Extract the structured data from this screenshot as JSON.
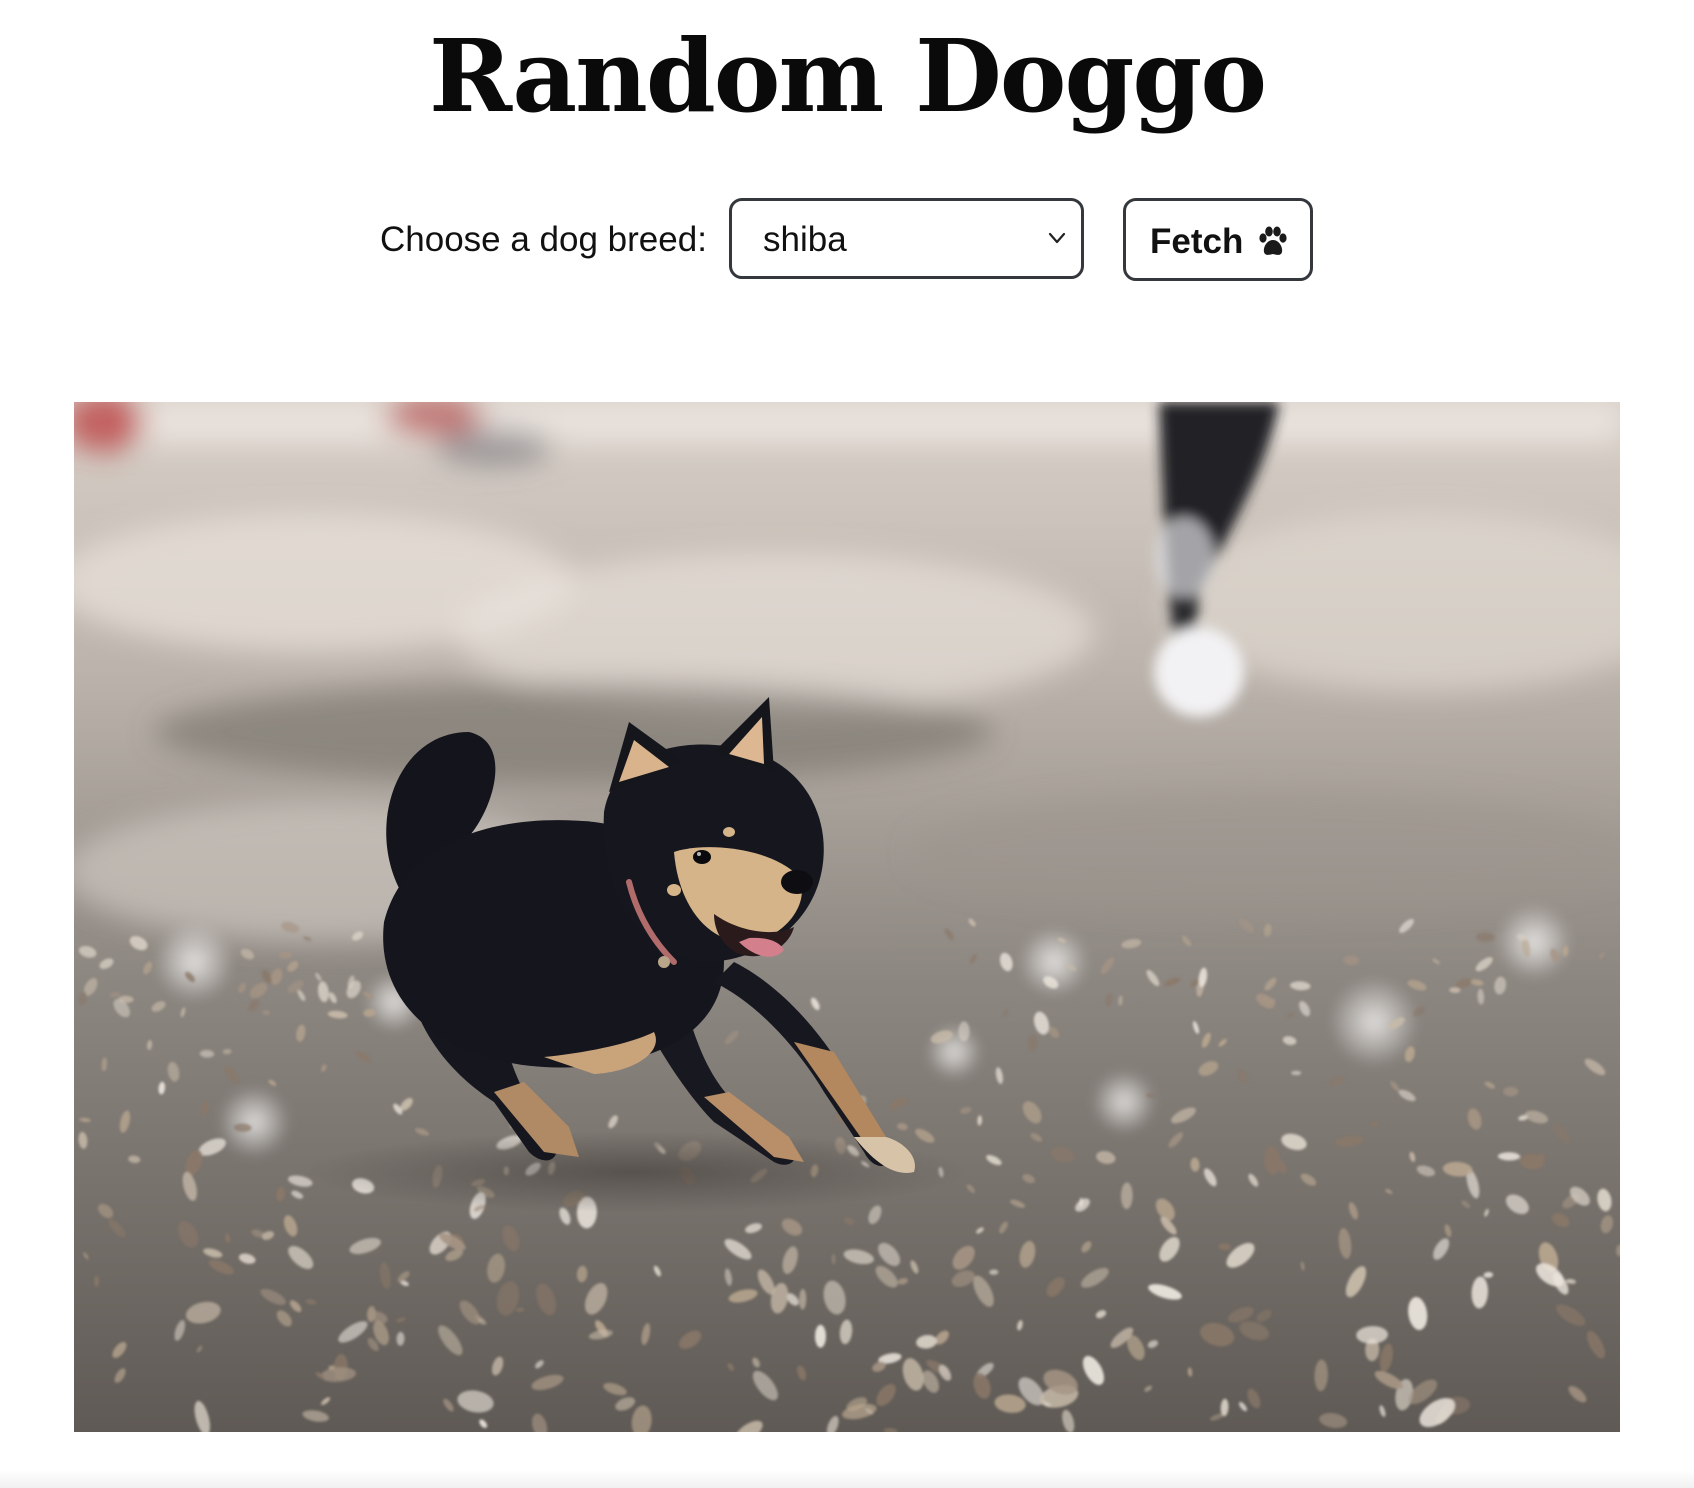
{
  "page": {
    "title": "Random Doggo"
  },
  "controls": {
    "breed_label": "Choose a dog breed:",
    "breed_select": {
      "selected": "shiba"
    },
    "fetch_button": {
      "label": "Fetch",
      "icon": "paw-icon"
    }
  },
  "photo": {
    "subject_icon": "dog-photo"
  },
  "colors": {
    "border": "#34383d",
    "text": "#111111",
    "background": "#ffffff"
  }
}
